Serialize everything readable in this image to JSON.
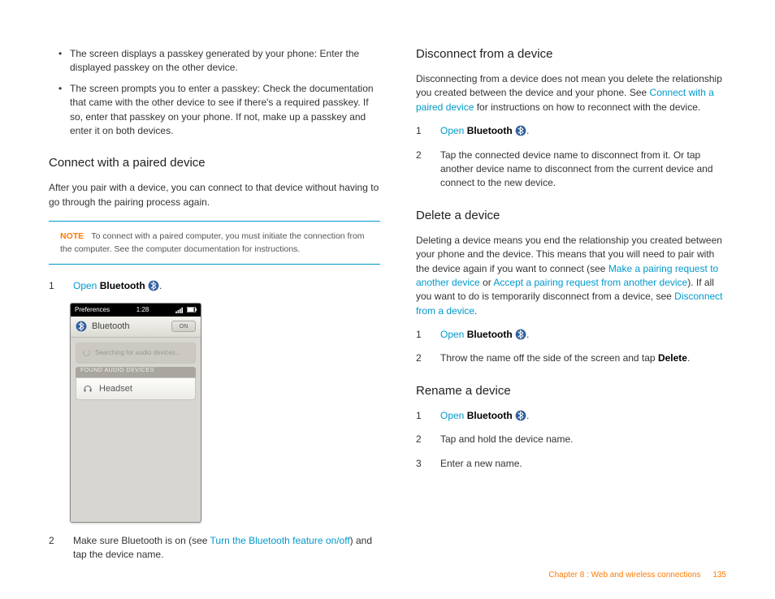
{
  "left": {
    "bullets": [
      "The screen displays a passkey generated by your phone: Enter the displayed passkey on the other device.",
      "The screen prompts you to enter a passkey: Check the documentation that came with the other device to see if there's a required passkey. If so, enter that passkey on your phone. If not, make up a passkey and enter it on both devices."
    ],
    "h_connect": "Connect with a paired device",
    "p_connect": "After you pair with a device, you can connect to that device without having to go through the pairing process again.",
    "note_label": "NOTE",
    "note_text": "To connect with a paired computer, you must initiate the connection from the computer. See the computer documentation for instructions.",
    "step1_open": "Open",
    "step1_bt": "Bluetooth",
    "phone": {
      "prefs": "Preferences",
      "time": "1:28",
      "title": "Bluetooth",
      "toggle": "ON",
      "searching": "Searching for audio devices…",
      "section": "FOUND AUDIO DEVICES",
      "device": "Headset"
    },
    "step2_a": "Make sure Bluetooth is on (see ",
    "step2_link": "Turn the Bluetooth feature on/off",
    "step2_b": ") and tap the device name."
  },
  "right": {
    "h_disc": "Disconnect from a device",
    "p_disc_a": "Disconnecting from a device does not mean you delete the relationship you created between the device and your phone. See ",
    "p_disc_link": "Connect with a paired device",
    "p_disc_b": " for instructions on how to reconnect with the device.",
    "disc_step1_open": "Open",
    "disc_step1_bt": "Bluetooth",
    "disc_step2": "Tap the connected device name to disconnect from it. Or tap another device name to disconnect from the current device and connect to the new device.",
    "h_del": "Delete a device",
    "p_del_a": "Deleting a device means you end the relationship you created between your phone and the device. This means that you will need to pair with the device again if you want to connect (see ",
    "p_del_link1": "Make a pairing request to another device",
    "p_del_mid": " or ",
    "p_del_link2": "Accept a pairing request from another device",
    "p_del_b": "). If all you want to do is temporarily disconnect from a device, see ",
    "p_del_link3": "Disconnect from a device",
    "del_step1_open": "Open",
    "del_step1_bt": "Bluetooth",
    "del_step2_a": "Throw the name off the side of the screen and tap ",
    "del_step2_b": "Delete",
    "h_ren": "Rename a device",
    "ren_step1_open": "Open",
    "ren_step1_bt": "Bluetooth",
    "ren_step2": "Tap and hold the device name.",
    "ren_step3": "Enter a new name."
  },
  "footer": {
    "chapter": "Chapter 8 : Web and wireless connections",
    "page": "135"
  }
}
